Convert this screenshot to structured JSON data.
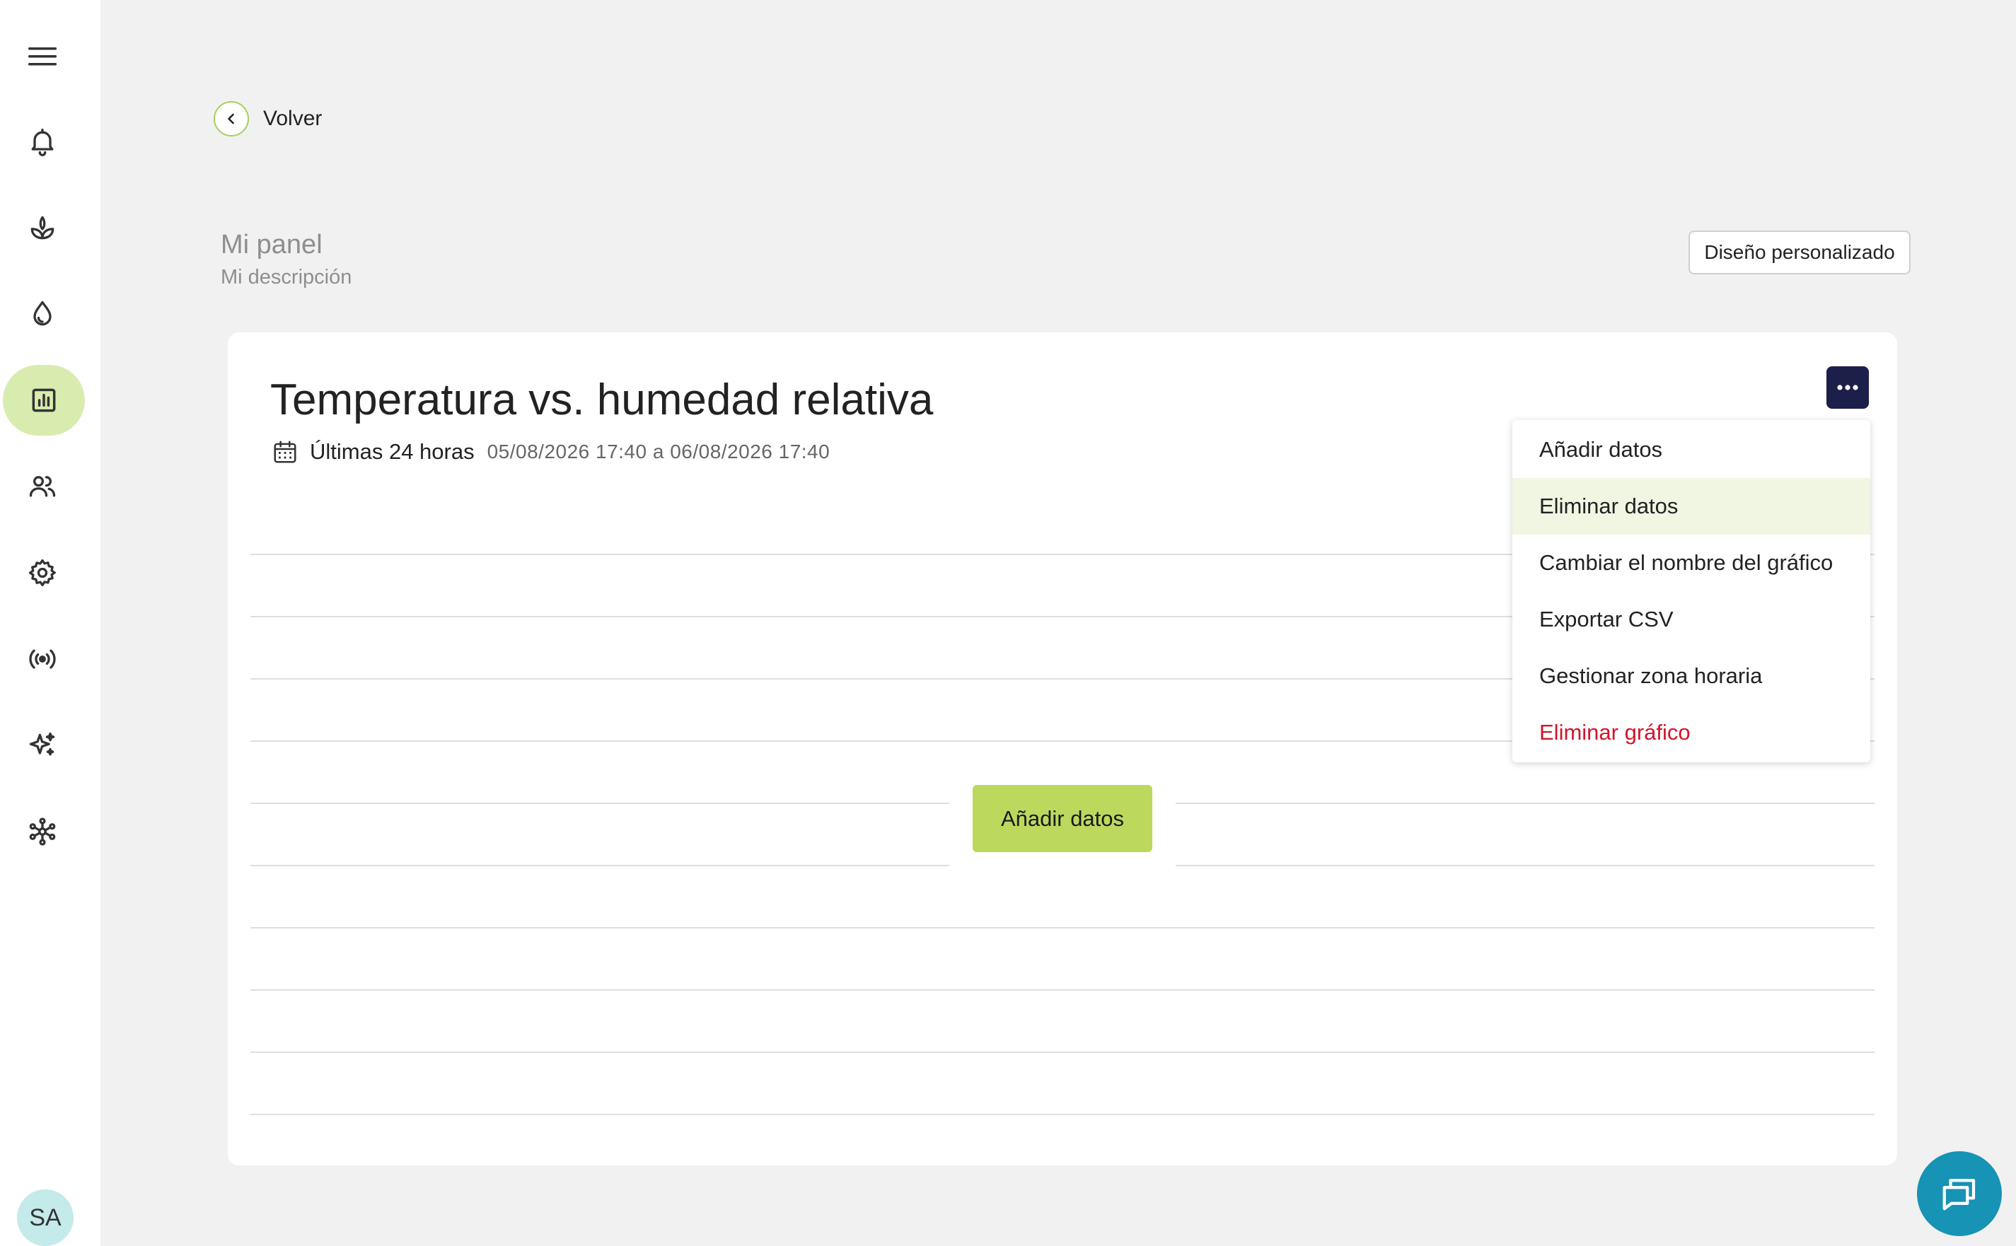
{
  "sidebar": {
    "items": [
      {
        "icon": "bell-icon"
      },
      {
        "icon": "plant-icon"
      },
      {
        "icon": "water-drop-icon"
      },
      {
        "icon": "chart-icon",
        "active": true
      },
      {
        "icon": "users-icon"
      },
      {
        "icon": "gear-icon"
      },
      {
        "icon": "broadcast-icon"
      },
      {
        "icon": "sparkles-icon"
      },
      {
        "icon": "network-icon"
      }
    ],
    "avatar_initials": "SA"
  },
  "back": {
    "label": "Volver"
  },
  "panel": {
    "title": "Mi panel",
    "description": "Mi descripción"
  },
  "custom_layout_label": "Diseño personalizado",
  "chart": {
    "title": "Temperatura vs. humedad relativa",
    "range_label": "Últimas 24 horas",
    "range_dates": "05/08/2026 17:40 a 06/08/2026 17:40",
    "add_data_label": "Añadir datos"
  },
  "menu": {
    "items": [
      {
        "label": "Añadir datos"
      },
      {
        "label": "Eliminar datos"
      },
      {
        "label": "Cambiar el nombre del gráfico"
      },
      {
        "label": "Exportar CSV"
      },
      {
        "label": "Gestionar zona horaria"
      },
      {
        "label": "Eliminar gráfico"
      }
    ]
  },
  "colors": {
    "accent": "#bcd95e",
    "nav_active_bg": "#d9ecaf",
    "more_button_bg": "#1c1f4a",
    "danger": "#d1152b",
    "chat_fab": "#1693b5"
  }
}
